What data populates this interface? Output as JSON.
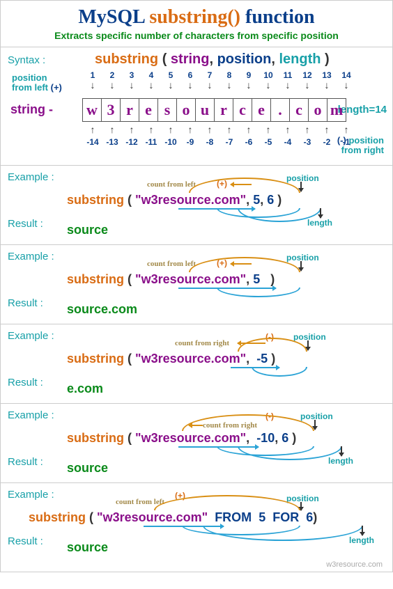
{
  "title_part1": "MySQL ",
  "title_fn": "substring()",
  "title_part2": " function",
  "subtitle": "Extracts specific number of characters from specific position",
  "labels": {
    "syntax": "Syntax :",
    "example": "Example :",
    "result": "Result :",
    "string": "string -",
    "length_eq": "length=14",
    "pos_from_left": "position\nfrom left",
    "pos_from_right": "position\nfrom right",
    "count_from_left": "count from left",
    "count_from_right": "count from right",
    "position": "position",
    "length": "length",
    "plus": "(+)",
    "minus": "(-)"
  },
  "syntax": {
    "fn": "substring",
    "p1": "string",
    "p2": "position",
    "p3": "length"
  },
  "chars": [
    "w",
    "3",
    "r",
    "e",
    "s",
    "o",
    "u",
    "r",
    "c",
    "e",
    ".",
    "c",
    "o",
    "m"
  ],
  "pos_top": [
    "1",
    "2",
    "3",
    "4",
    "5",
    "6",
    "7",
    "8",
    "9",
    "10",
    "11",
    "12",
    "13",
    "14"
  ],
  "pos_bot": [
    "-14",
    "-13",
    "-12",
    "-11",
    "-10",
    "-9",
    "-8",
    "-7",
    "-6",
    "-5",
    "-4",
    "-3",
    "-2",
    "-1"
  ],
  "examples": [
    {
      "call_html": "substring ( \"w3resource.com\", 5, 6 )",
      "args": {
        "str": "\"w3resource.com\"",
        "pos": "5",
        "len": "6"
      },
      "count": "left",
      "sign": "(+)",
      "result": "source"
    },
    {
      "call_html": "substring ( \"w3resource.com\", 5 )",
      "args": {
        "str": "\"w3resource.com\"",
        "pos": "5",
        "len": ""
      },
      "count": "left",
      "sign": "(+)",
      "result": "source.com"
    },
    {
      "call_html": "substring ( \"w3resource.com\", -5 )",
      "args": {
        "str": "\"w3resource.com\"",
        "pos": "-5",
        "len": ""
      },
      "count": "right",
      "sign": "(-)",
      "result": "e.com"
    },
    {
      "call_html": "substring ( \"w3resource.com\", -10, 6 )",
      "args": {
        "str": "\"w3resource.com\"",
        "pos": "-10",
        "len": "6"
      },
      "count": "right",
      "sign": "(-)",
      "result": "source"
    },
    {
      "from_for": true,
      "args": {
        "str": "\"w3resource.com\"",
        "pos": "5",
        "len": "6"
      },
      "count": "left",
      "sign": "(+)",
      "result": "source"
    }
  ],
  "footer": "w3resource.com"
}
